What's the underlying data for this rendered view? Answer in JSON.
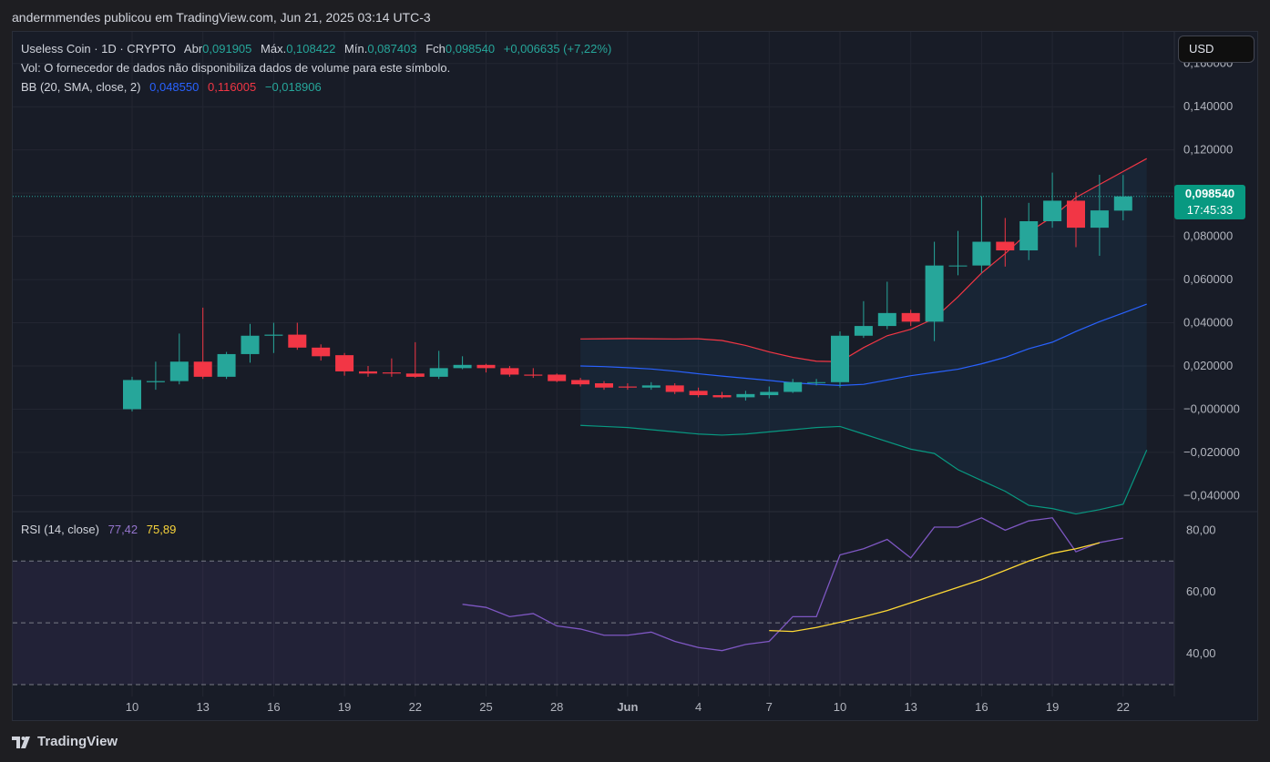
{
  "header": {
    "publish_line": "andermmendes publicou em TradingView.com, Jun 21, 2025 03:14 UTC-3"
  },
  "legend": {
    "symbol": "Useless Coin · 1D · CRYPTO",
    "open_label": "Abr",
    "open_value": "0,091905",
    "high_label": "Máx.",
    "high_value": "0,108422",
    "low_label": "Mín.",
    "low_value": "0,087403",
    "close_label": "Fch",
    "close_value": "0,098540",
    "change_value": "+0,006635 (+7,22%)",
    "volume_note": "Vol: O fornecedor de dados não disponibiliza dados de volume para este símbolo.",
    "bb_label": "BB (20, SMA, close, 2)",
    "bb_basis": "0,048550",
    "bb_upper": "0,116005",
    "bb_lower": "−0,018906",
    "rsi_label": "RSI (14, close)",
    "rsi_value": "77,42",
    "rsi_ma_value": "75,89"
  },
  "currency_button": "USD",
  "last_price": {
    "price": "0,098540",
    "countdown": "17:45:33"
  },
  "footer_brand": "TradingView",
  "colors": {
    "up": "#26a69a",
    "down": "#f23645",
    "bb_basis": "#2962ff",
    "bb_upper": "#f23645",
    "bb_lower": "#089981",
    "rsi": "#7e57c2",
    "rsi_ma": "#fdd835"
  },
  "chart_data": {
    "type": "candlestick",
    "x_tick_labels": [
      "10",
      "13",
      "16",
      "19",
      "22",
      "25",
      "28",
      "Jun",
      "4",
      "7",
      "10",
      "13",
      "16",
      "19",
      "22"
    ],
    "y_tick_labels": [
      "0,160000",
      "0,140000",
      "0,120000",
      "0,100000",
      "0,080000",
      "0,060000",
      "0,040000",
      "0,020000",
      "−0,000000",
      "−0,020000",
      "−0,040000"
    ],
    "ylim": [
      -0.047,
      0.162
    ],
    "dates": [
      "May 10",
      "May 11",
      "May 12",
      "May 13",
      "May 14",
      "May 15",
      "May 16",
      "May 17",
      "May 18",
      "May 19",
      "May 20",
      "May 21",
      "May 22",
      "May 23",
      "May 24",
      "May 25",
      "May 26",
      "May 27",
      "May 28",
      "May 29",
      "May 30",
      "May 31",
      "Jun 1",
      "Jun 2",
      "Jun 3",
      "Jun 4",
      "Jun 5",
      "Jun 6",
      "Jun 7",
      "Jun 8",
      "Jun 9",
      "Jun 10",
      "Jun 11",
      "Jun 12",
      "Jun 13",
      "Jun 14",
      "Jun 15",
      "Jun 16",
      "Jun 17",
      "Jun 18",
      "Jun 19",
      "Jun 20",
      "Jun 21"
    ],
    "ohlc": [
      [
        0.0,
        0.015,
        -0.001,
        0.0135
      ],
      [
        0.0125,
        0.022,
        0.009,
        0.013
      ],
      [
        0.013,
        0.035,
        0.0115,
        0.022
      ],
      [
        0.022,
        0.047,
        0.014,
        0.015
      ],
      [
        0.015,
        0.0265,
        0.014,
        0.0255
      ],
      [
        0.0255,
        0.0395,
        0.0215,
        0.034
      ],
      [
        0.034,
        0.04,
        0.026,
        0.0345
      ],
      [
        0.0345,
        0.04,
        0.0275,
        0.0285
      ],
      [
        0.0285,
        0.03,
        0.0225,
        0.0245
      ],
      [
        0.025,
        0.026,
        0.0155,
        0.0175
      ],
      [
        0.0175,
        0.02,
        0.015,
        0.0165
      ],
      [
        0.017,
        0.0235,
        0.015,
        0.0165
      ],
      [
        0.0165,
        0.031,
        0.0145,
        0.015
      ],
      [
        0.015,
        0.027,
        0.014,
        0.019
      ],
      [
        0.019,
        0.0245,
        0.0185,
        0.0205
      ],
      [
        0.0205,
        0.021,
        0.017,
        0.019
      ],
      [
        0.019,
        0.02,
        0.015,
        0.016
      ],
      [
        0.016,
        0.019,
        0.0145,
        0.0155
      ],
      [
        0.016,
        0.0165,
        0.0125,
        0.013
      ],
      [
        0.0135,
        0.0145,
        0.0105,
        0.0115
      ],
      [
        0.012,
        0.013,
        0.009,
        0.01
      ],
      [
        0.0105,
        0.012,
        0.009,
        0.01
      ],
      [
        0.01,
        0.0125,
        0.009,
        0.011
      ],
      [
        0.011,
        0.012,
        0.007,
        0.008
      ],
      [
        0.0085,
        0.01,
        0.0055,
        0.0065
      ],
      [
        0.0065,
        0.008,
        0.005,
        0.0055
      ],
      [
        0.0055,
        0.0085,
        0.004,
        0.007
      ],
      [
        0.0065,
        0.0105,
        0.005,
        0.008
      ],
      [
        0.008,
        0.014,
        0.0075,
        0.0125
      ],
      [
        0.0125,
        0.014,
        0.011,
        0.0125
      ],
      [
        0.0125,
        0.036,
        0.01,
        0.034
      ],
      [
        0.034,
        0.05,
        0.033,
        0.0385
      ],
      [
        0.0385,
        0.059,
        0.037,
        0.0445
      ],
      [
        0.0445,
        0.046,
        0.0385,
        0.0405
      ],
      [
        0.0405,
        0.0775,
        0.0315,
        0.0665
      ],
      [
        0.0665,
        0.0825,
        0.062,
        0.0665
      ],
      [
        0.0665,
        0.0985,
        0.063,
        0.0775
      ],
      [
        0.0775,
        0.0885,
        0.066,
        0.0735
      ],
      [
        0.0735,
        0.0955,
        0.069,
        0.087
      ],
      [
        0.087,
        0.1095,
        0.084,
        0.0965
      ],
      [
        0.0965,
        0.1005,
        0.075,
        0.084
      ],
      [
        0.084,
        0.1085,
        0.071,
        0.092
      ],
      [
        0.0919,
        0.1084,
        0.0874,
        0.0985
      ]
    ],
    "bollinger": {
      "start_index": 19,
      "upper": [
        0.0325,
        0.0326,
        0.0327,
        0.0326,
        0.0325,
        0.0326,
        0.0318,
        0.0295,
        0.0265,
        0.024,
        0.0222,
        0.022,
        0.0285,
        0.034,
        0.037,
        0.042,
        0.052,
        0.063,
        0.072,
        0.082,
        0.089,
        0.098,
        0.104,
        0.11,
        0.116
      ],
      "basis": [
        0.02,
        0.0197,
        0.0192,
        0.0186,
        0.0176,
        0.0164,
        0.0153,
        0.0143,
        0.0133,
        0.0122,
        0.0115,
        0.011,
        0.0115,
        0.0135,
        0.0155,
        0.017,
        0.0185,
        0.021,
        0.024,
        0.028,
        0.031,
        0.036,
        0.0405,
        0.0445,
        0.0486
      ],
      "lower": [
        -0.0075,
        -0.008,
        -0.0085,
        -0.0095,
        -0.0105,
        -0.0115,
        -0.012,
        -0.0115,
        -0.0105,
        -0.0095,
        -0.0085,
        -0.008,
        -0.0115,
        -0.015,
        -0.0185,
        -0.0205,
        -0.028,
        -0.033,
        -0.038,
        -0.0445,
        -0.046,
        -0.0485,
        -0.0465,
        -0.044,
        -0.0189
      ]
    },
    "rsi": {
      "ylim": [
        30,
        86
      ],
      "y_tick_labels": [
        "80,00",
        "60,00",
        "40,00"
      ],
      "overbought": 70,
      "middle": 50,
      "oversold": 30,
      "rsi_start_index": 14,
      "rsi_values": [
        56,
        55,
        52,
        53,
        49,
        48,
        46,
        46,
        47,
        44,
        42,
        41,
        43,
        44,
        52,
        52,
        72,
        74,
        77,
        71,
        81,
        81,
        84,
        80,
        83,
        84,
        73,
        76,
        77.42
      ],
      "ma_start_index": 27,
      "ma_values": [
        47.5,
        47.2,
        48.5,
        50.2,
        52,
        54,
        56.5,
        59,
        61.5,
        64,
        67,
        70,
        72.5,
        74,
        75.89
      ]
    }
  }
}
